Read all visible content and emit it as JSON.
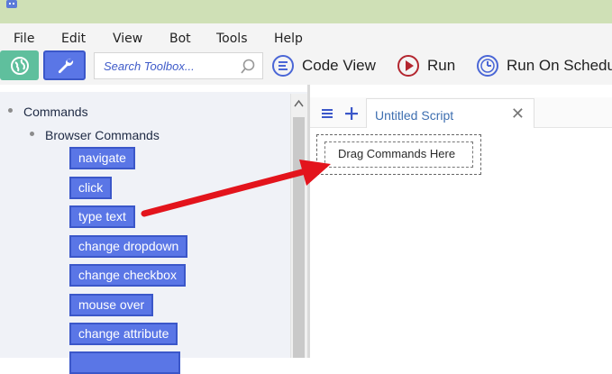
{
  "menu": {
    "items": [
      "File",
      "Edit",
      "View",
      "Bot",
      "Tools",
      "Help"
    ]
  },
  "toolbar": {
    "search_placeholder": "Search Toolbox...",
    "code_view_label": "Code View",
    "run_label": "Run",
    "run_on_schedule_label": "Run On Schedu",
    "colors": {
      "globe_button": "#5fbf9d",
      "wrench_button": "#5a76e6"
    }
  },
  "tree": {
    "root_label": "Commands",
    "group_label": "Browser Commands",
    "commands": [
      "navigate",
      "click",
      "type text",
      "change dropdown",
      "change checkbox",
      "mouse over",
      "change attribute"
    ]
  },
  "editor": {
    "tab_label": "Untitled Script",
    "tab_close": "✕",
    "dropzone_label": "Drag Commands Here"
  },
  "annotation": {
    "arrow_color": "#e3141c"
  }
}
